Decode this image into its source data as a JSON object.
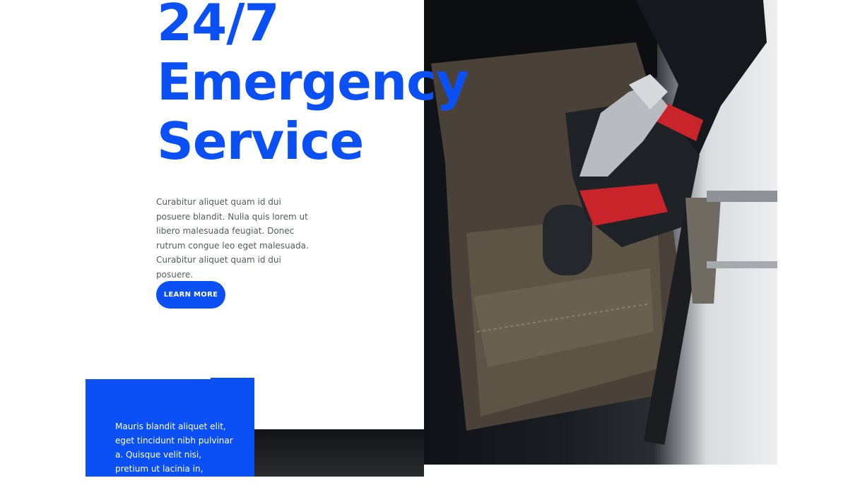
{
  "hero": {
    "headline_lines": [
      "24/7",
      "Emergency",
      "Service"
    ],
    "body": "Curabitur aliquet quam id dui posuere blandit. Nulla quis lorem ut libero malesuada feugiat. Donec rutrum congue leo eget malesuada. Curabitur aliquet quam id dui posuere.",
    "cta_label": "LEARN MORE"
  },
  "card": {
    "text": "Mauris blandit aliquet elit, eget tincidunt nibh pulvinar a. Quisque velit nisi, pretium ut lacinia in, elementum id"
  },
  "colors": {
    "accent": "#0a50f5",
    "body_text": "#555a60"
  },
  "images": {
    "hero_photo": "worker-tool-belt-photo",
    "secondary_photo": "dark-photo-strip"
  }
}
